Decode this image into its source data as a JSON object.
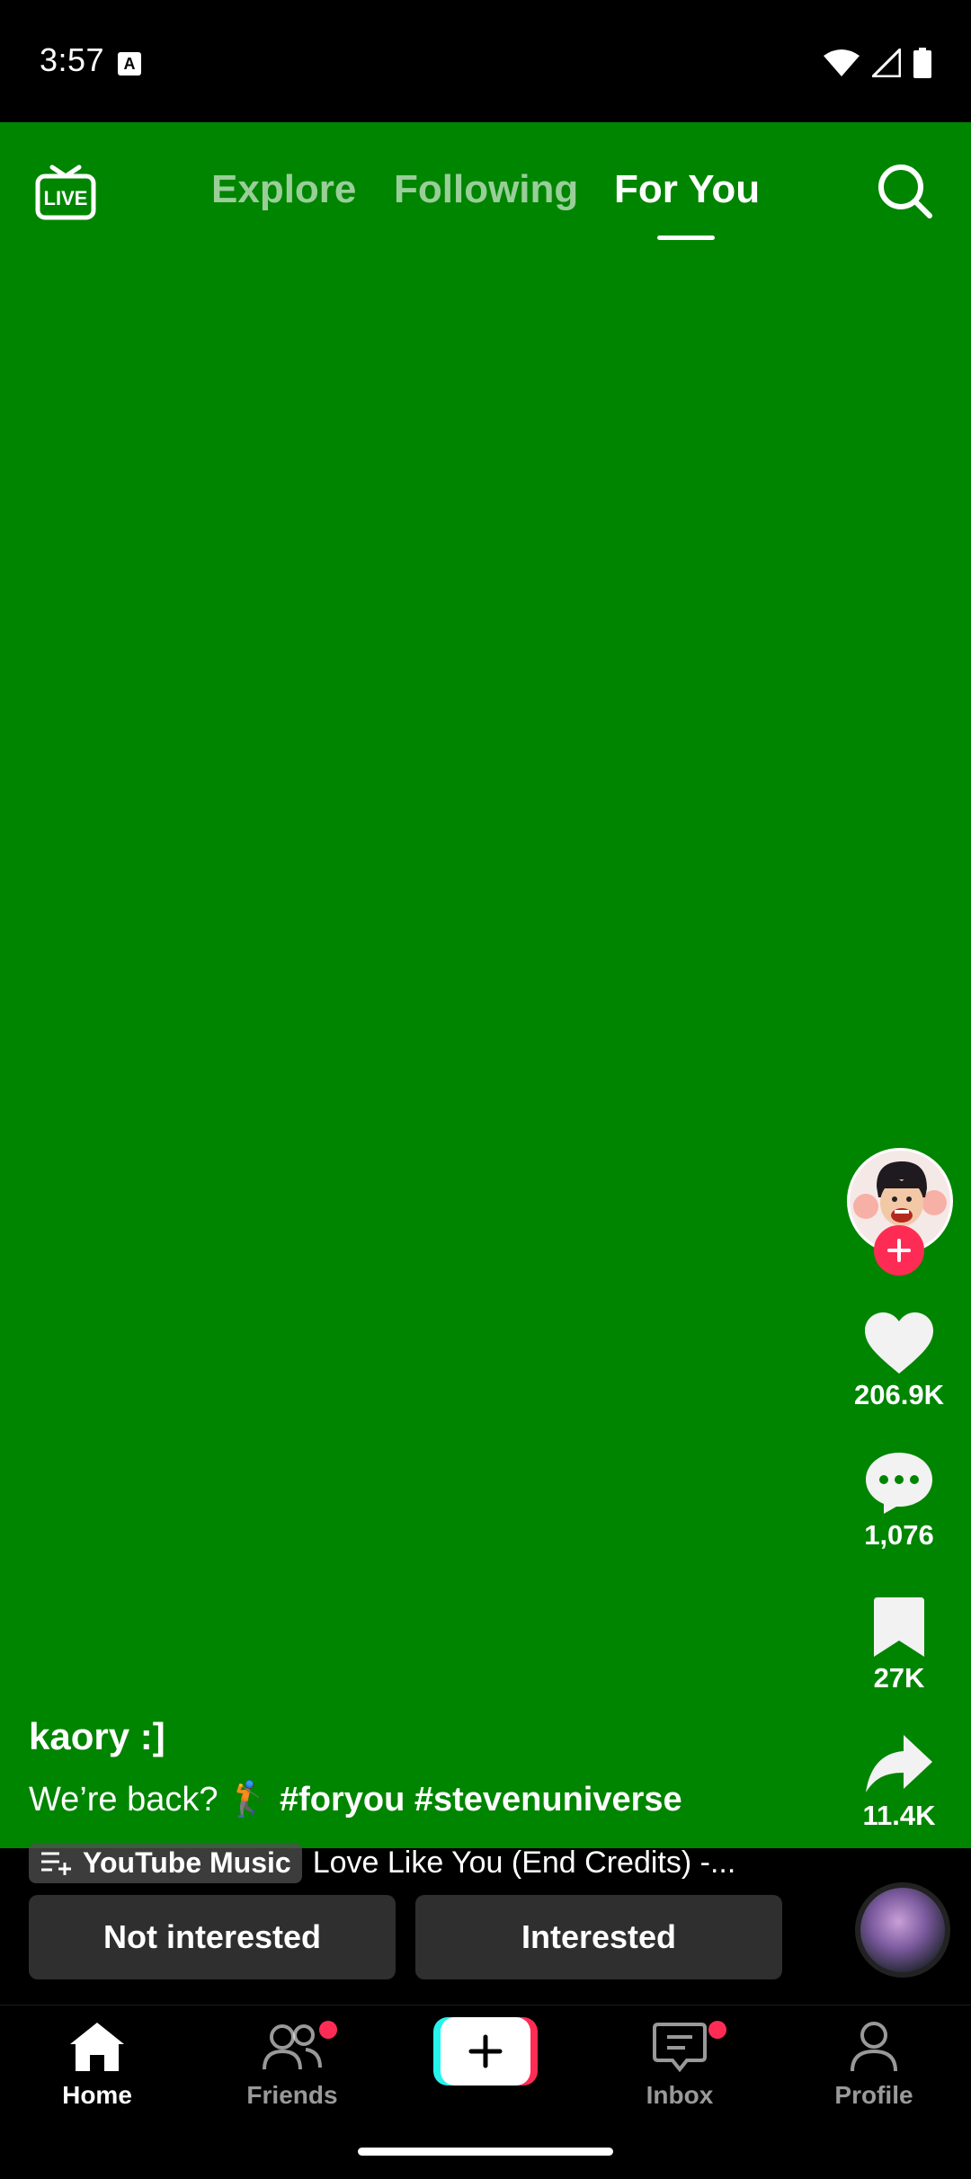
{
  "status_bar": {
    "time": "3:57",
    "notification_letter": "A"
  },
  "colors": {
    "video_bg": "#008500",
    "accent_red": "#fe2c55",
    "accent_cyan": "#25f4ee"
  },
  "top_bar": {
    "live_label": "LIVE",
    "tabs": [
      {
        "label": "Explore",
        "active": false
      },
      {
        "label": "Following",
        "active": false
      },
      {
        "label": "For You",
        "active": true
      }
    ],
    "search_icon": "search-icon"
  },
  "actions": {
    "likes": "206.9K",
    "comments": "1,076",
    "saves": "27K",
    "shares": "11.4K"
  },
  "post": {
    "username": "kaory :]",
    "caption_text": "We’re back? 🏌",
    "hashtags": "#foryou #stevenuniverse",
    "music_chip": "YouTube Music",
    "song": "Love Like You (End Credits) -..."
  },
  "interest": {
    "not_interested": "Not interested",
    "interested": "Interested"
  },
  "nav": {
    "home": "Home",
    "friends": "Friends",
    "inbox": "Inbox",
    "profile": "Profile"
  }
}
